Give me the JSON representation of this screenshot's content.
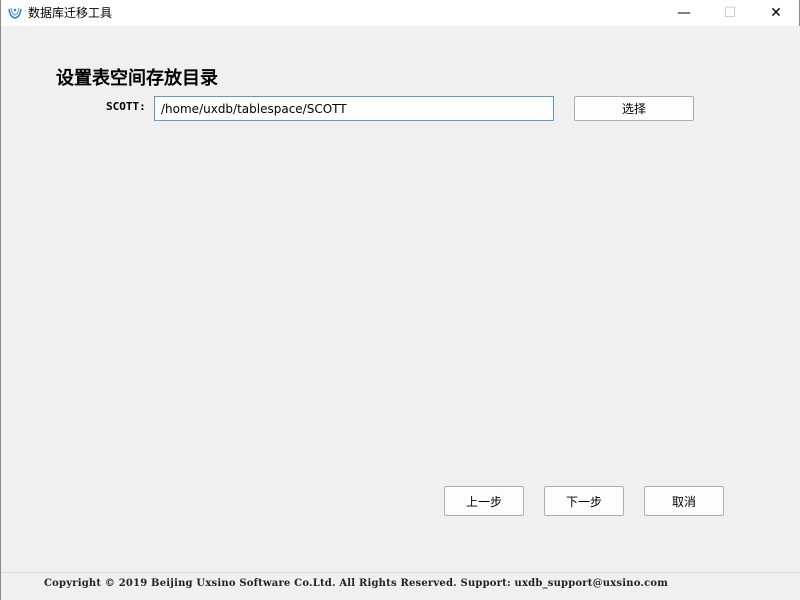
{
  "window": {
    "title": "数据库迁移工具",
    "minimize_glyph": "—",
    "maximize_glyph": "☐",
    "close_glyph": "✕"
  },
  "main": {
    "heading": "设置表空间存放目录",
    "tablespace_row": {
      "label": "SCOTT:",
      "path_value": "/home/uxdb/tablespace/SCOTT",
      "choose_button": "选择"
    }
  },
  "nav": {
    "prev_button": "上一步",
    "next_button": "下一步",
    "cancel_button": "取消"
  },
  "footer": {
    "copyright": "Copyright © 2019 Beijing Uxsino Software Co.Ltd. All Rights Reserved. Support: uxdb_support@uxsino.com"
  }
}
